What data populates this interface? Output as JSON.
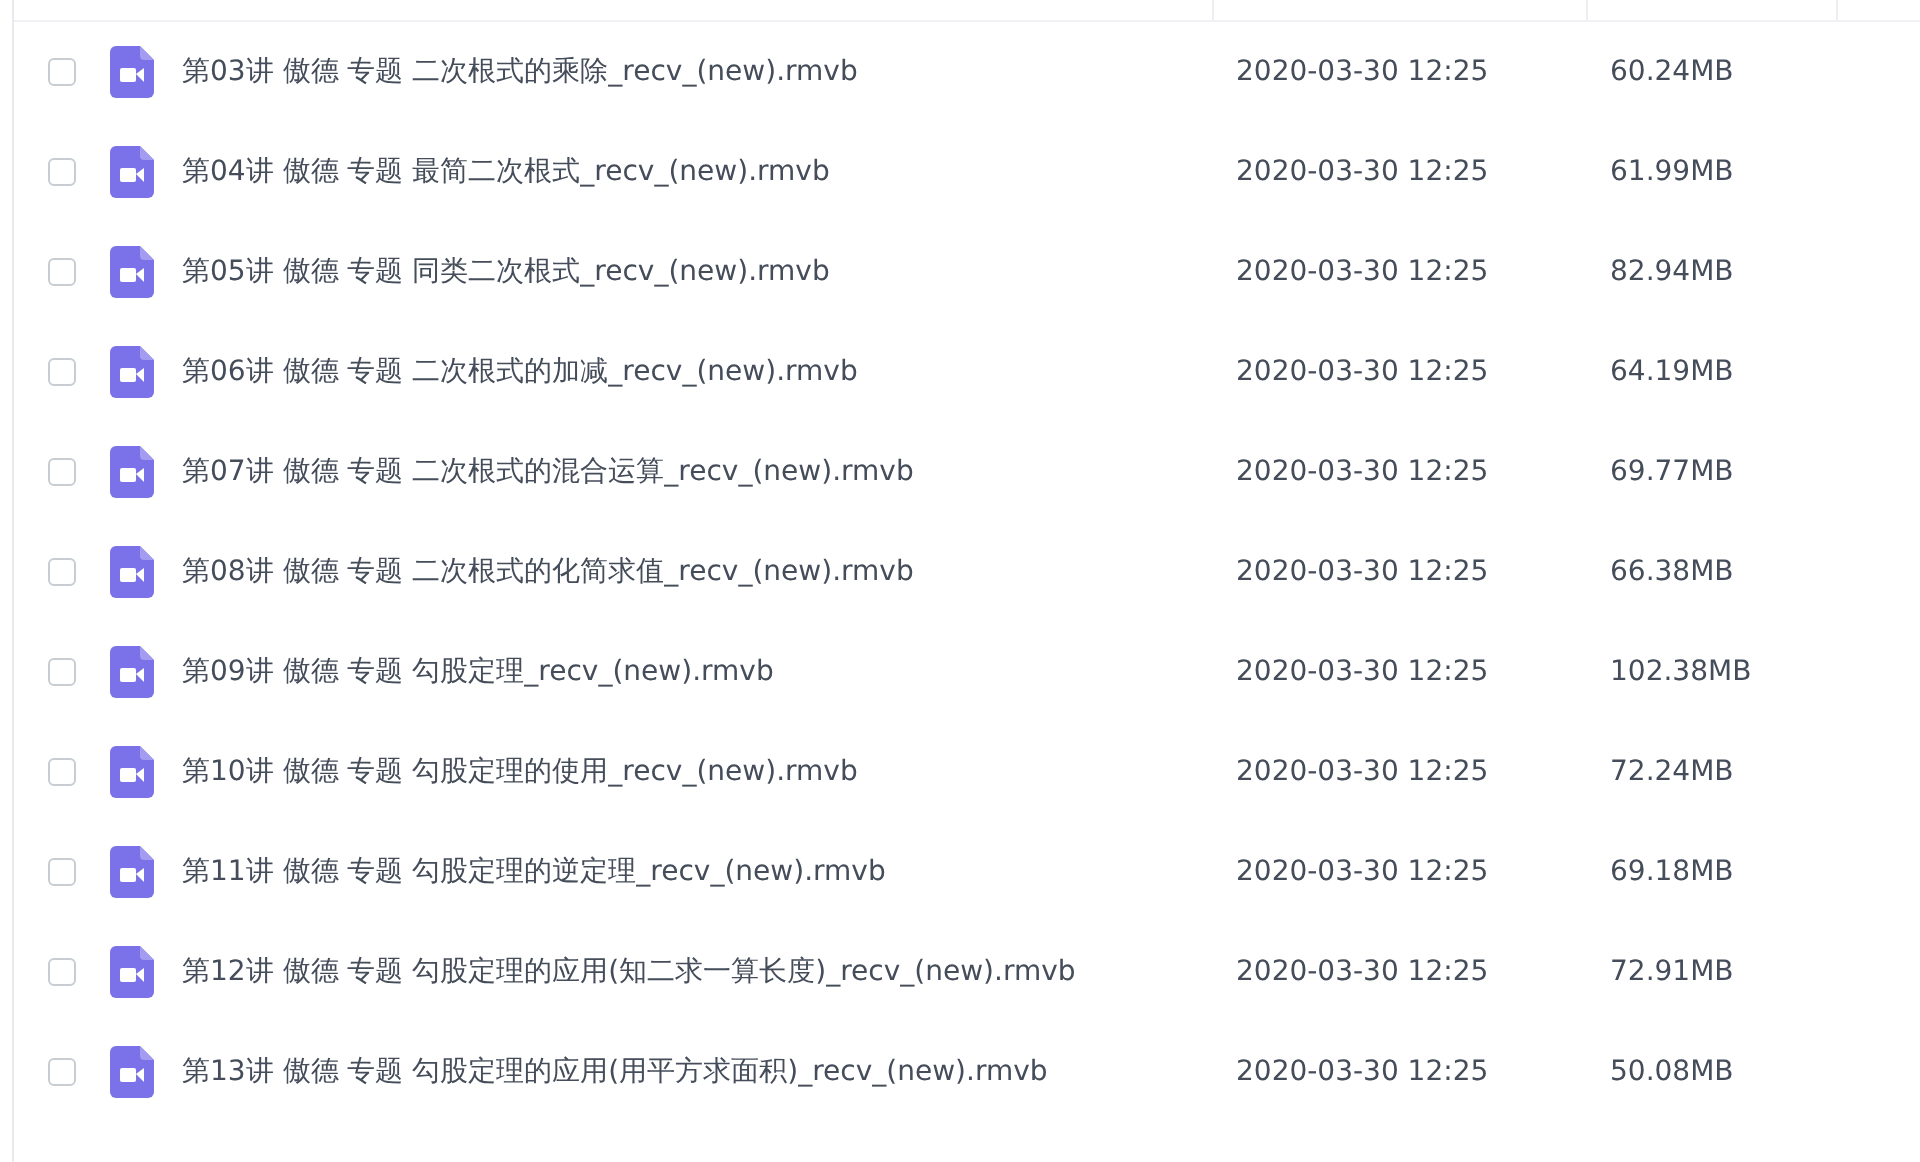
{
  "files": [
    {
      "name": "第03讲 傲德 专题 二次根式的乘除_recv_(new).rmvb",
      "modified": "2020-03-30 12:25",
      "size": "60.24MB",
      "checked": false
    },
    {
      "name": "第04讲 傲德 专题 最简二次根式_recv_(new).rmvb",
      "modified": "2020-03-30 12:25",
      "size": "61.99MB",
      "checked": false
    },
    {
      "name": "第05讲 傲德 专题 同类二次根式_recv_(new).rmvb",
      "modified": "2020-03-30 12:25",
      "size": "82.94MB",
      "checked": false
    },
    {
      "name": "第06讲 傲德 专题 二次根式的加减_recv_(new).rmvb",
      "modified": "2020-03-30 12:25",
      "size": "64.19MB",
      "checked": false
    },
    {
      "name": "第07讲 傲德 专题 二次根式的混合运算_recv_(new).rmvb",
      "modified": "2020-03-30 12:25",
      "size": "69.77MB",
      "checked": false
    },
    {
      "name": "第08讲 傲德 专题 二次根式的化简求值_recv_(new).rmvb",
      "modified": "2020-03-30 12:25",
      "size": "66.38MB",
      "checked": false
    },
    {
      "name": "第09讲 傲德 专题 勾股定理_recv_(new).rmvb",
      "modified": "2020-03-30 12:25",
      "size": "102.38MB",
      "checked": false
    },
    {
      "name": "第10讲 傲德 专题 勾股定理的使用_recv_(new).rmvb",
      "modified": "2020-03-30 12:25",
      "size": "72.24MB",
      "checked": false
    },
    {
      "name": "第11讲 傲德 专题 勾股定理的逆定理_recv_(new).rmvb",
      "modified": "2020-03-30 12:25",
      "size": "69.18MB",
      "checked": false
    },
    {
      "name": "第12讲 傲德 专题 勾股定理的应用(知二求一算长度)_recv_(new).rmvb",
      "modified": "2020-03-30 12:25",
      "size": "72.91MB",
      "checked": false
    },
    {
      "name": "第13讲 傲德 专题 勾股定理的应用(用平方求面积)_recv_(new).rmvb",
      "modified": "2020-03-30 12:25",
      "size": "50.08MB",
      "checked": false
    }
  ]
}
